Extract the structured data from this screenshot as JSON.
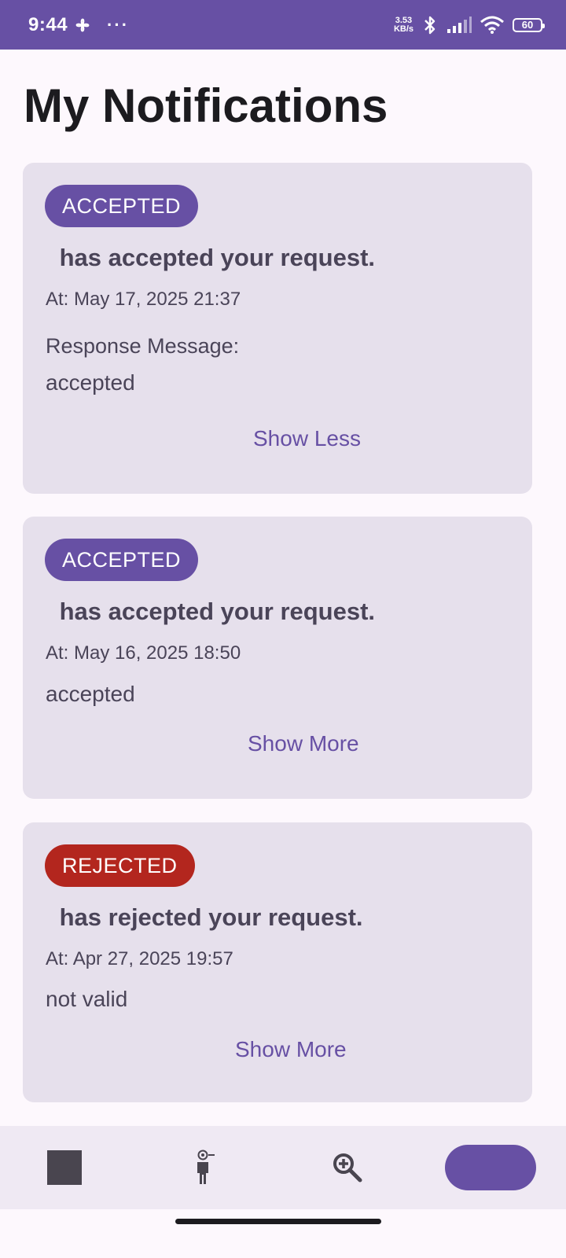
{
  "status_bar": {
    "time": "9:44",
    "dots": "···",
    "net_speed_value": "3.53",
    "net_speed_unit": "KB/s",
    "battery": "60"
  },
  "page": {
    "title": "My Notifications"
  },
  "notifications": [
    {
      "status": "ACCEPTED",
      "title": " has accepted your request.",
      "time": "At: May 17, 2025 21:37",
      "response_label": "Response Message:",
      "message": "accepted",
      "toggle": "Show Less"
    },
    {
      "status": "ACCEPTED",
      "title": " has accepted your request.",
      "time": "At: May 16, 2025 18:50",
      "message": "accepted",
      "toggle": "Show More"
    },
    {
      "status": "REJECTED",
      "title": " has rejected your request.",
      "time": "At: Apr 27, 2025 19:57",
      "message": "not valid",
      "toggle": "Show More"
    }
  ],
  "bottom_nav": {
    "items": [
      {
        "icon": "square-icon"
      },
      {
        "icon": "person-icon"
      },
      {
        "icon": "zoom-in-icon"
      },
      {
        "icon": "pill-indicator"
      }
    ]
  },
  "colors": {
    "primary": "#6750a4",
    "rejected": "#b3261e",
    "card_bg": "#e6e0ec",
    "page_bg": "#fdf8fd"
  }
}
